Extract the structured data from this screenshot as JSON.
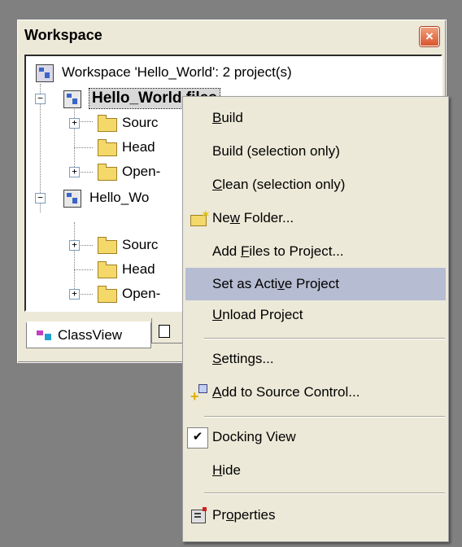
{
  "panel": {
    "title": "Workspace",
    "close_glyph": "×"
  },
  "tree": {
    "workspace_label": "Workspace 'Hello_World': 2 project(s)",
    "project1_label": "Hello_World files",
    "project2_label": "Hello_Wo",
    "items": [
      {
        "label": "Sourc"
      },
      {
        "label": "Head"
      },
      {
        "label": "Open-"
      },
      {
        "label": "Sourc"
      },
      {
        "label": "Head"
      },
      {
        "label": "Open-"
      }
    ]
  },
  "tabs": {
    "classview": "ClassView"
  },
  "menu": {
    "items": [
      {
        "pre": "",
        "key": "B",
        "post": "uild"
      },
      {
        "pre": "",
        "key": "",
        "post": "Build (selection only)"
      },
      {
        "pre": "",
        "key": "C",
        "post": "lean (selection only)"
      },
      {
        "pre": "Ne",
        "key": "w",
        "post": " Folder..."
      },
      {
        "pre": "Add ",
        "key": "F",
        "post": "iles to Project..."
      },
      {
        "pre": "Set as Acti",
        "key": "v",
        "post": "e Project"
      },
      {
        "pre": "",
        "key": "U",
        "post": "nload Project"
      },
      {
        "pre": "",
        "key": "S",
        "post": "ettings..."
      },
      {
        "pre": "",
        "key": "A",
        "post": "dd to Source Control..."
      },
      {
        "pre": "",
        "key": "",
        "post": "Docking View"
      },
      {
        "pre": "",
        "key": "H",
        "post": "ide"
      },
      {
        "pre": "Pr",
        "key": "o",
        "post": "perties"
      }
    ],
    "highlight_color": "#b6bdd2",
    "checkmark": "✔"
  }
}
